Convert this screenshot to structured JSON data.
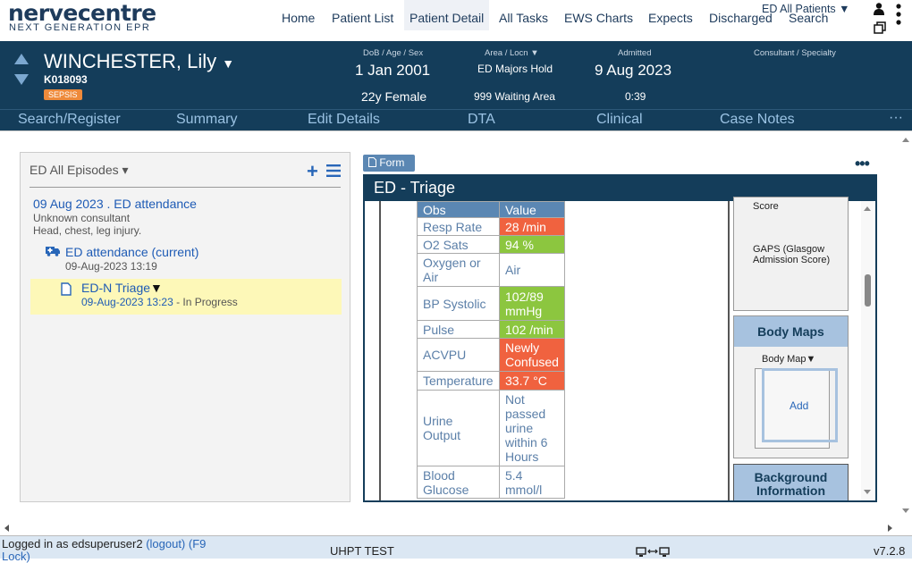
{
  "app": {
    "logo": "nervecentre",
    "logo_sub": "NEXT GENERATION EPR"
  },
  "nav": {
    "home": "Home",
    "patient_list": "Patient List",
    "patient_detail": "Patient Detail",
    "all_tasks": "All Tasks",
    "ews_charts": "EWS Charts",
    "expects": "Expects",
    "discharged": "Discharged",
    "search": "Search",
    "ward_selector": "ED All Patients ▼"
  },
  "patient": {
    "name": "WINCHESTER, Lily",
    "name_caret": "▼",
    "id": "K018093",
    "alert": "SEPSIS",
    "dob_label": "DoB / Age / Sex",
    "dob": "1 Jan 2001",
    "age_sex": "22y Female",
    "area_label": "Area / Locn ▼",
    "area": "ED Majors Hold",
    "location": "999 Waiting Area",
    "admitted_label": "Admitted",
    "admitted": "9 Aug 2023",
    "admitted_time": "0:39",
    "consultant_label": "Consultant / Specialty"
  },
  "subnav": {
    "search_register": "Search/Register",
    "summary": "Summary",
    "edit_details": "Edit Details",
    "dta": "DTA",
    "clinical": "Clinical",
    "case_notes": "Case Notes",
    "more": "···"
  },
  "episodes": {
    "filter": "ED All Episodes ▾",
    "episode_title": "09 Aug 2023 . ED attendance",
    "episode_consultant": "Unknown consultant",
    "episode_complaint": "Head, chest, leg injury.",
    "attendance_title": "ED attendance (current)",
    "attendance_date": "09-Aug-2023 13:19",
    "triage_title": "ED-N Triage",
    "triage_caret": "▼",
    "triage_date": "09-Aug-2023 13:23",
    "triage_status": " - In Progress"
  },
  "form": {
    "button": "Form",
    "title": "ED - Triage",
    "menu": "•••",
    "obs_header": "Obs",
    "value_header": "Value",
    "rows": [
      {
        "label": "Resp Rate",
        "value": "28 /min",
        "status": "red"
      },
      {
        "label": "O2 Sats",
        "value": "94 %",
        "status": "green"
      },
      {
        "label": "Oxygen or Air",
        "value": "Air",
        "status": "none"
      },
      {
        "label": "BP Systolic",
        "value": "102/89 mmHg",
        "status": "green"
      },
      {
        "label": "Pulse",
        "value": "102 /min",
        "status": "green"
      },
      {
        "label": "ACVPU",
        "value": "Newly Confused",
        "status": "red"
      },
      {
        "label": "Temperature",
        "value": "33.7 °C",
        "status": "red"
      },
      {
        "label": "Urine Output",
        "value": "Not passed urine within 6 Hours",
        "status": "none"
      },
      {
        "label": "Blood Glucose",
        "value": "5.4 mmol/l",
        "status": "none"
      }
    ],
    "score_label": "Score",
    "gaps_label": "GAPS (Glasgow Admission Score)",
    "body_maps_title": "Body Maps",
    "body_map_select": "Body Map▼",
    "body_map_add": "Add",
    "background_title": "Background Information"
  },
  "footer": {
    "logged_in": "Logged in as edsuperuser2",
    "logout": "(logout)",
    "lock": "(F9 Lock)",
    "org": "UHPT TEST",
    "version": "v7.2.8"
  },
  "colors": {
    "navy": "#143d5a",
    "red": "#f0623f",
    "green": "#8cc63f",
    "link": "#2866b8"
  }
}
